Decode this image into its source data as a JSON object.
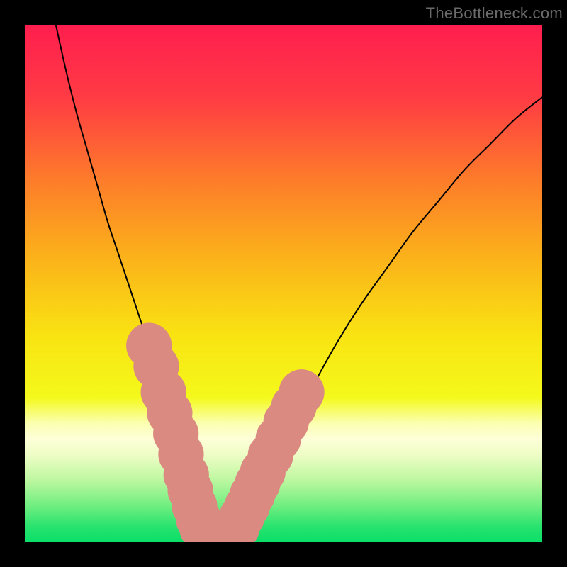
{
  "watermark": "TheBottleneck.com",
  "chart_data": {
    "type": "line",
    "title": "",
    "xlabel": "",
    "ylabel": "",
    "xlim": [
      0,
      100
    ],
    "ylim": [
      0,
      100
    ],
    "grid": false,
    "legend": false,
    "gradient_stops": [
      {
        "offset": 0.0,
        "color": "#ff1e4e"
      },
      {
        "offset": 0.14,
        "color": "#ff3b44"
      },
      {
        "offset": 0.3,
        "color": "#fd7c2a"
      },
      {
        "offset": 0.45,
        "color": "#fbb21a"
      },
      {
        "offset": 0.6,
        "color": "#f9e312"
      },
      {
        "offset": 0.72,
        "color": "#f4f91b"
      },
      {
        "offset": 0.77,
        "color": "#fbffb0"
      },
      {
        "offset": 0.8,
        "color": "#feffd8"
      },
      {
        "offset": 0.83,
        "color": "#effdc6"
      },
      {
        "offset": 0.88,
        "color": "#bdf7a0"
      },
      {
        "offset": 0.93,
        "color": "#6fee80"
      },
      {
        "offset": 0.97,
        "color": "#28e36e"
      },
      {
        "offset": 1.0,
        "color": "#0adf68"
      }
    ],
    "series": [
      {
        "name": "bottleneck-curve",
        "color": "#000000",
        "x": [
          6,
          8,
          10,
          12,
          14,
          16,
          18,
          20,
          22,
          24,
          26,
          28,
          30,
          31,
          32,
          33,
          34,
          36,
          38,
          40,
          42,
          44,
          46,
          50,
          55,
          60,
          65,
          70,
          75,
          80,
          85,
          90,
          95,
          100
        ],
        "y": [
          100,
          91,
          83,
          76,
          69,
          62,
          56,
          50,
          44,
          38,
          32,
          26,
          19,
          15,
          11,
          7,
          4,
          1,
          0,
          1,
          4,
          8,
          12,
          20,
          29,
          38,
          46,
          53,
          60,
          66,
          72,
          77,
          82,
          86
        ]
      }
    ],
    "markers": {
      "name": "highlight-dots",
      "color": "#db8a82",
      "radius": 2.0,
      "points": [
        {
          "x": 24.0,
          "y": 38.0
        },
        {
          "x": 25.4,
          "y": 34.0
        },
        {
          "x": 26.8,
          "y": 29.0
        },
        {
          "x": 28.0,
          "y": 25.0
        },
        {
          "x": 29.2,
          "y": 21.0
        },
        {
          "x": 30.2,
          "y": 17.0
        },
        {
          "x": 31.2,
          "y": 13.0
        },
        {
          "x": 32.0,
          "y": 10.0
        },
        {
          "x": 32.8,
          "y": 7.0
        },
        {
          "x": 33.6,
          "y": 4.4
        },
        {
          "x": 34.3,
          "y": 2.6
        },
        {
          "x": 35.0,
          "y": 1.4
        },
        {
          "x": 36.0,
          "y": 0.6
        },
        {
          "x": 37.0,
          "y": 0.2
        },
        {
          "x": 38.0,
          "y": 0.2
        },
        {
          "x": 39.0,
          "y": 0.6
        },
        {
          "x": 40.0,
          "y": 1.4
        },
        {
          "x": 41.0,
          "y": 2.8
        },
        {
          "x": 42.0,
          "y": 5.0
        },
        {
          "x": 43.0,
          "y": 7.0
        },
        {
          "x": 44.0,
          "y": 9.2
        },
        {
          "x": 45.0,
          "y": 11.4
        },
        {
          "x": 46.0,
          "y": 13.6
        },
        {
          "x": 47.5,
          "y": 16.8
        },
        {
          "x": 49.0,
          "y": 20.0
        },
        {
          "x": 50.5,
          "y": 23.2
        },
        {
          "x": 52.0,
          "y": 26.2
        },
        {
          "x": 53.5,
          "y": 29.0
        }
      ]
    }
  }
}
